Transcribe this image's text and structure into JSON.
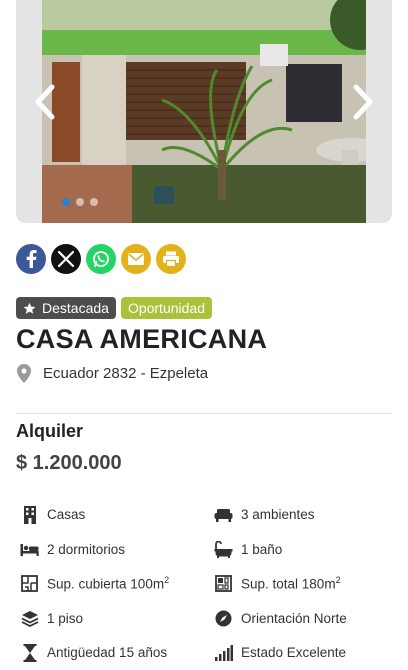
{
  "gallery": {
    "prev_icon": "chevron-left-icon",
    "next_icon": "chevron-right-icon",
    "dot_count": 3,
    "active_dot": 0
  },
  "share": {
    "buttons": [
      {
        "name": "facebook",
        "color": "#3b5998",
        "icon": "facebook-icon"
      },
      {
        "name": "x",
        "color": "#111111",
        "icon": "x-icon"
      },
      {
        "name": "whatsapp",
        "color": "#25d366",
        "icon": "whatsapp-icon"
      },
      {
        "name": "email",
        "color": "#e2b21d",
        "icon": "envelope-icon"
      },
      {
        "name": "print",
        "color": "#e2b21d",
        "icon": "printer-icon"
      }
    ]
  },
  "badges": {
    "featured": "Destacada",
    "opportunity": "Oportunidad",
    "featured_color": "#4d4d4d",
    "opportunity_color": "#a8c23a"
  },
  "property": {
    "title": "CASA AMERICANA",
    "address": "Ecuador 2832 - Ezpeleta",
    "operation": "Alquiler",
    "price": "$ 1.200.000"
  },
  "features": {
    "type": "Casas",
    "rooms": "3 ambientes",
    "bedrooms": "2 dormitorios",
    "bathrooms": "1 baño",
    "covered_area_label": "Sup. cubierta 100m",
    "covered_area_sup": "2",
    "total_area_label": "Sup. total 180m",
    "total_area_sup": "2",
    "floors": "1 piso",
    "orientation": "Orientación Norte",
    "age": "Antigüedad 15 años",
    "condition": "Estado Excelente"
  }
}
